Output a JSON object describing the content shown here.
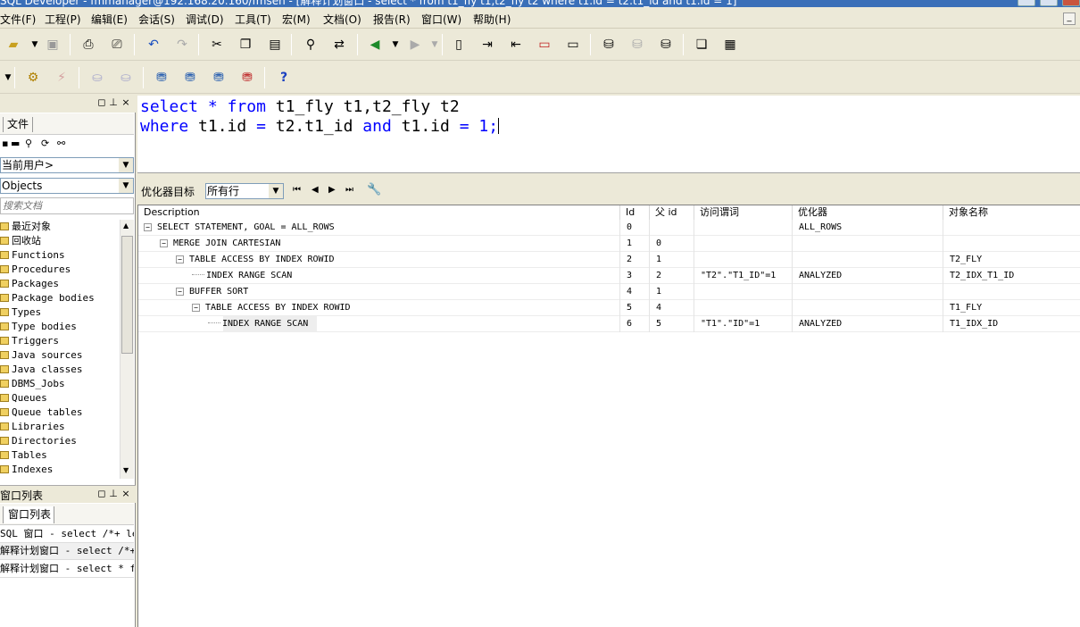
{
  "window": {
    "title": "SQL Developer - fmmanager@192.168.20.160/fmsen - [解释计划窗口 - select * from t1_fly t1,t2_fly t2 where t1.id = t2.t1_id and t1.id = 1]"
  },
  "menu": [
    "文件(F)",
    "工程(P)",
    "编辑(E)",
    "会话(S)",
    "调试(D)",
    "工具(T)",
    "宏(M)",
    "文档(O)",
    "报告(R)",
    "窗口(W)",
    "帮助(H)"
  ],
  "left_panel": {
    "tab_label": "文件",
    "user_combo": "当前用户>",
    "objects_combo": "Objects",
    "search_placeholder": "搜索文档",
    "tree": [
      "最近对象",
      "回收站",
      "Functions",
      "Procedures",
      "Packages",
      "Package bodies",
      "Types",
      "Type bodies",
      "Triggers",
      "Java sources",
      "Java classes",
      "DBMS_Jobs",
      "Queues",
      "Queue tables",
      "Libraries",
      "Directories",
      "Tables",
      "Indexes"
    ],
    "window_list_header": "窗口列表",
    "window_list_tab": "窗口列表",
    "windows": [
      "SQL 窗口 - select /*+ leading",
      "解释计划窗口 - select /*+us",
      "解释计划窗口 - select * fro"
    ]
  },
  "editor": {
    "line1": {
      "kw1": "select",
      "op": "*",
      "kw2": "from",
      "rest": "t1_fly t1,t2_fly t2"
    },
    "line2": {
      "kw1": "where",
      "a": "t1.id",
      "eq1": "=",
      "b": "t2.t1_id",
      "kw2": "and",
      "c": "t1.id",
      "eq2": "=",
      "d": "1;"
    }
  },
  "optimizer": {
    "label": "优化器目标",
    "value": "所有行"
  },
  "plan": {
    "columns": [
      "Description",
      "Id",
      "父 id",
      "访问谓词",
      "优化器",
      "对象名称"
    ],
    "rows": [
      {
        "desc": "SELECT STATEMENT, GOAL = ALL_ROWS",
        "id": "0",
        "pid": "",
        "pred": "",
        "opt": "ALL_ROWS",
        "obj": ""
      },
      {
        "desc": "MERGE JOIN CARTESIAN",
        "id": "1",
        "pid": "0",
        "pred": "",
        "opt": "",
        "obj": ""
      },
      {
        "desc": "TABLE ACCESS BY INDEX ROWID",
        "id": "2",
        "pid": "1",
        "pred": "",
        "opt": "",
        "obj": "T2_FLY"
      },
      {
        "desc": "INDEX RANGE SCAN",
        "id": "3",
        "pid": "2",
        "pred": "\"T2\".\"T1_ID\"=1",
        "opt": "ANALYZED",
        "obj": "T2_IDX_T1_ID"
      },
      {
        "desc": "BUFFER SORT",
        "id": "4",
        "pid": "1",
        "pred": "",
        "opt": "",
        "obj": ""
      },
      {
        "desc": "TABLE ACCESS BY INDEX ROWID",
        "id": "5",
        "pid": "4",
        "pred": "",
        "opt": "",
        "obj": "T1_FLY"
      },
      {
        "desc": "INDEX RANGE SCAN",
        "id": "6",
        "pid": "5",
        "pred": "\"T1\".\"ID\"=1",
        "opt": "ANALYZED",
        "obj": "T1_IDX_ID"
      }
    ]
  },
  "icons": [
    "open-icon",
    "save-icon",
    "print-icon",
    "undo-icon",
    "redo-icon",
    "cut-icon",
    "copy-icon",
    "paste-icon",
    "find-icon",
    "replace-icon",
    "help-icon"
  ]
}
